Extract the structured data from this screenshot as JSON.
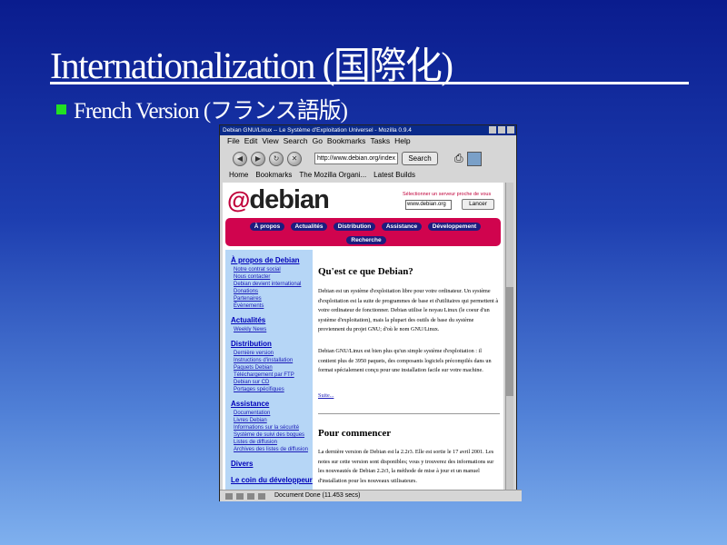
{
  "slide": {
    "title": "Internationalization (国際化)",
    "bullet": "French Version (フランス語版)"
  },
  "browser": {
    "title": "Debian GNU/Linux -- Le Système d'Exploitation Universel - Mozilla 0.9.4",
    "menu": [
      "File",
      "Edit",
      "View",
      "Search",
      "Go",
      "Bookmarks",
      "Tasks",
      "Help"
    ],
    "url": "http://www.debian.org/index",
    "search_label": "Search",
    "bookmarks": [
      "Home",
      "Bookmarks",
      "The Mozilla Organi...",
      "Latest Builds"
    ],
    "status": "Document Done (11.453 secs)",
    "page": {
      "logo": "debian",
      "mirror_label": "Sélectionner un serveur proche de vous",
      "mirror_value": "www.debian.org",
      "mirror_button": "Lancer",
      "nav": [
        "À propos",
        "Actualités",
        "Distribution",
        "Assistance",
        "Développement",
        "Recherche"
      ],
      "left": {
        "apropos": {
          "head": "À propos de Debian",
          "items": [
            "Notre contrat social",
            "Nous contacter",
            "Debian devient international",
            "Donations",
            "Partenaires",
            "Évènements"
          ]
        },
        "actu": {
          "head": "Actualités",
          "items": [
            "Weekly News"
          ]
        },
        "distrib": {
          "head": "Distribution",
          "items": [
            "Dernière version",
            "Instructions d'installation",
            "Paquets Debian",
            "Téléchargement par FTP",
            "Debian sur CD",
            "Portages spécifiques"
          ]
        },
        "assist": {
          "head": "Assistance",
          "items": [
            "Documentation",
            "Livres Debian",
            "Informations sur la sécurité",
            "Système de suivi des bogues",
            "Listes de diffusion",
            "Archives des listes de diffusion"
          ]
        },
        "divers": {
          "head": "Divers"
        },
        "dev": {
          "head": "Le coin du développeur"
        }
      },
      "main": {
        "h1": "Qu'est ce que Debian?",
        "p1": "Debian est un système d'exploitation libre pour votre ordinateur. Un système d'exploitation est la suite de programmes de base et d'utilitaires qui permettent à votre ordinateur de fonctionner. Debian utilise le noyau Linux (le coeur d'un système d'exploitation), mais la plupart des outils de base du système proviennent du projet GNU; d'où le nom GNU/Linux.",
        "p2": "Debian GNU/Linux est bien plus qu'un simple système d'exploitation : il contient plus de 3950 paquets, des composants logiciels précompilés dans un format spécialement conçu pour une installation facile sur votre machine.",
        "suite": "Suite...",
        "h2": "Pour commencer",
        "p3": "La dernière version de Debian est la 2.2r3. Elle est sortie le 17 avril 2001. Les notes sur cette version sont disponibles; vous y trouverez des informations sur les nouveautés de Debian 2.2r3, la méthode de mise à jour et un manuel d'installation pour les nouveaux utilisateurs."
      }
    }
  }
}
